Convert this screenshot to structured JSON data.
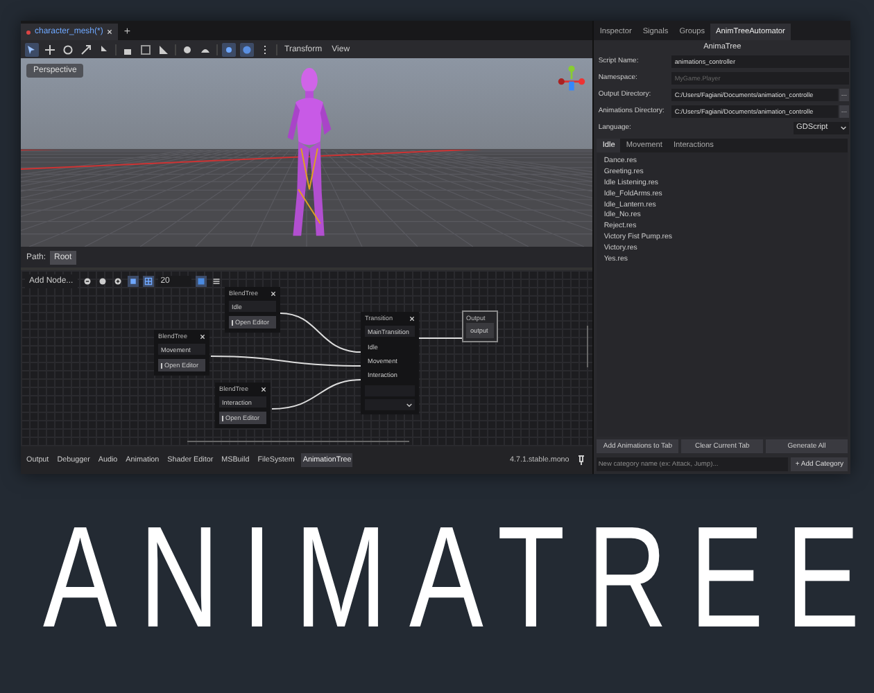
{
  "editor_tabs": [
    {
      "label": "character_mesh(*)",
      "selected": true
    }
  ],
  "new_tab": "+",
  "toolbar": {
    "menus": [
      "Transform",
      "View"
    ]
  },
  "viewport": {
    "mode": "Perspective"
  },
  "path_bar": {
    "label": "Path:",
    "crumb": "Root"
  },
  "graph": {
    "add_node": "Add Node...",
    "snap_value": "20",
    "blend_nodes": [
      {
        "title": "BlendTree",
        "port": "Idle",
        "button": "Open Editor"
      },
      {
        "title": "BlendTree",
        "port": "Movement",
        "button": "Open Editor"
      },
      {
        "title": "BlendTree",
        "port": "Interaction",
        "button": "Open Editor"
      }
    ],
    "transition": {
      "title": "Transition",
      "output": "MainTransition",
      "inputs": [
        "Idle",
        "Movement",
        "Interaction"
      ]
    },
    "output": {
      "title": "Output",
      "port": "output"
    }
  },
  "bottom_tabs": [
    {
      "label": "Output",
      "selected": false
    },
    {
      "label": "Debugger",
      "selected": false
    },
    {
      "label": "Audio",
      "selected": false
    },
    {
      "label": "Animation",
      "selected": false
    },
    {
      "label": "Shader Editor",
      "selected": false
    },
    {
      "label": "MSBuild",
      "selected": false
    },
    {
      "label": "FileSystem",
      "selected": false
    },
    {
      "label": "AnimationTree",
      "selected": true
    }
  ],
  "version": "4.7.1.stable.mono",
  "dock": {
    "tabs": [
      {
        "label": "Inspector",
        "selected": false
      },
      {
        "label": "Signals",
        "selected": false
      },
      {
        "label": "Groups",
        "selected": false
      },
      {
        "label": "AnimTreeAutomator",
        "selected": true
      }
    ],
    "heading": "AnimaTree",
    "fields": [
      {
        "label": "Script Name:",
        "value": "animations_controller"
      },
      {
        "label": "Namespace:",
        "placeholder": "MyGame.Player"
      },
      {
        "label": "Output Directory:",
        "value": "C:/Users/Fagiani/Documents/animation_controlle",
        "browse": "..."
      },
      {
        "label": "Animations Directory:",
        "value": "C:/Users/Fagiani/Documents/animation_controlle",
        "browse": "..."
      }
    ],
    "language": {
      "label": "Language:",
      "value": "GDScript"
    },
    "category_tabs": [
      {
        "label": "Idle",
        "selected": true
      },
      {
        "label": "Movement",
        "selected": false
      },
      {
        "label": "Interactions",
        "selected": false
      }
    ],
    "animations": [
      "Dance.res",
      "Greeting.res",
      "Idle Listening.res",
      "Idle_FoldArms.res",
      "Idle_Lantern.res",
      "Idle_No.res",
      "Reject.res",
      "Victory Fist Pump.res",
      "Victory.res",
      "Yes.res"
    ],
    "buttons": [
      "Add Animations to Tab",
      "Clear Current Tab",
      "Generate All"
    ],
    "category_input": {
      "placeholder": "New category name (ex: Attack, Jump)..."
    },
    "add_button": "+ Add Category"
  },
  "title": "ANIMATREE"
}
